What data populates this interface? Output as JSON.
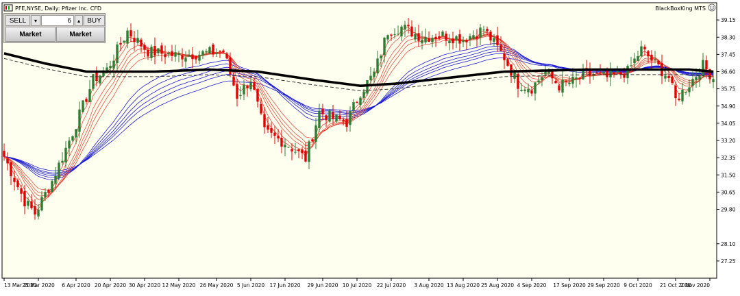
{
  "window": {
    "symbol_title": "PFE,NYSE, Daily:  Pfizer Inc. CFD",
    "indicator_label": "BlackBoxKing MTS"
  },
  "trade_panel": {
    "sell_label": "SELL",
    "dropdown_icon": "chevron-down-icon",
    "lots_value": "6",
    "increment_icon": "chevron-up-icon",
    "buy_label": "BUY",
    "market_sell_label": "Market",
    "market_buy_label": "Market"
  },
  "colors": {
    "background": "#fffff0",
    "bull_candle": "#2e7d32",
    "bear_candle": "#e00000",
    "slow_ma_lines": "#1a1ad2",
    "fast_ma_lines": "#e33b2a",
    "main_trend_line": "#000000"
  },
  "chart_data": {
    "type": "candlestick",
    "title": "PFE,NYSE, Daily:  Pfizer Inc. CFD",
    "ylim": [
      26.4,
      40.0
    ],
    "y_ticks": [
      "39.15",
      "38.30",
      "37.45",
      "36.60",
      "35.75",
      "34.90",
      "34.05",
      "33.20",
      "32.35",
      "31.50",
      "30.65",
      "29.80",
      "28.10",
      "27.25"
    ],
    "x_ticks": [
      "13 Mar 2020",
      "25 Mar 2020",
      "6 Apr 2020",
      "20 Apr 2020",
      "30 Apr 2020",
      "12 May 2020",
      "26 May 2020",
      "5 Jun 2020",
      "17 Jun 2020",
      "29 Jun 2020",
      "10 Jul 2020",
      "22 Jul 2020",
      "3 Aug 2020",
      "13 Aug 2020",
      "25 Aug 2020",
      "4 Sep 2020",
      "17 Sep 2020",
      "29 Sep 2020",
      "9 Oct 2020",
      "21 Oct 2020",
      "2 Nov 2020"
    ],
    "close_path": [
      {
        "bar": 0,
        "close": 32.4
      },
      {
        "bar": 6,
        "close": 30.2
      },
      {
        "bar": 9,
        "close": 29.6
      },
      {
        "bar": 14,
        "close": 31.2
      },
      {
        "bar": 20,
        "close": 33.6
      },
      {
        "bar": 26,
        "close": 36.2
      },
      {
        "bar": 30,
        "close": 36.7
      },
      {
        "bar": 36,
        "close": 38.6
      },
      {
        "bar": 42,
        "close": 37.6
      },
      {
        "bar": 50,
        "close": 37.4
      },
      {
        "bar": 58,
        "close": 37.5
      },
      {
        "bar": 64,
        "close": 37.6
      },
      {
        "bar": 68,
        "close": 35.4
      },
      {
        "bar": 72,
        "close": 36.2
      },
      {
        "bar": 76,
        "close": 33.6
      },
      {
        "bar": 82,
        "close": 33.1
      },
      {
        "bar": 88,
        "close": 32.3
      },
      {
        "bar": 92,
        "close": 34.6
      },
      {
        "bar": 96,
        "close": 34.3
      },
      {
        "bar": 100,
        "close": 34.1
      },
      {
        "bar": 104,
        "close": 35.6
      },
      {
        "bar": 108,
        "close": 36.5
      },
      {
        "bar": 112,
        "close": 38.6
      },
      {
        "bar": 116,
        "close": 38.8
      },
      {
        "bar": 122,
        "close": 38.3
      },
      {
        "bar": 128,
        "close": 38.4
      },
      {
        "bar": 134,
        "close": 38.2
      },
      {
        "bar": 140,
        "close": 38.7
      },
      {
        "bar": 146,
        "close": 37.3
      },
      {
        "bar": 150,
        "close": 36.0
      },
      {
        "bar": 154,
        "close": 35.8
      },
      {
        "bar": 158,
        "close": 36.6
      },
      {
        "bar": 162,
        "close": 35.9
      },
      {
        "bar": 166,
        "close": 36.1
      },
      {
        "bar": 170,
        "close": 36.5
      },
      {
        "bar": 176,
        "close": 36.3
      },
      {
        "bar": 182,
        "close": 36.6
      },
      {
        "bar": 186,
        "close": 37.7
      },
      {
        "bar": 190,
        "close": 37.0
      },
      {
        "bar": 194,
        "close": 36.3
      },
      {
        "bar": 196,
        "close": 35.2
      },
      {
        "bar": 200,
        "close": 36.0
      },
      {
        "bar": 204,
        "close": 36.9
      },
      {
        "bar": 207,
        "close": 36.3
      }
    ],
    "trend_line_path": [
      {
        "bar": 0,
        "value": 37.5
      },
      {
        "bar": 12,
        "value": 37.0
      },
      {
        "bar": 24,
        "value": 36.6
      },
      {
        "bar": 44,
        "value": 36.6
      },
      {
        "bar": 60,
        "value": 36.7
      },
      {
        "bar": 74,
        "value": 36.6
      },
      {
        "bar": 90,
        "value": 36.2
      },
      {
        "bar": 104,
        "value": 35.9
      },
      {
        "bar": 114,
        "value": 36.0
      },
      {
        "bar": 130,
        "value": 36.3
      },
      {
        "bar": 146,
        "value": 36.6
      },
      {
        "bar": 170,
        "value": 36.7
      },
      {
        "bar": 186,
        "value": 36.7
      },
      {
        "bar": 200,
        "value": 36.7
      },
      {
        "bar": 207,
        "value": 36.6
      }
    ],
    "bar_count": 208,
    "grid": false,
    "legend": "none"
  }
}
